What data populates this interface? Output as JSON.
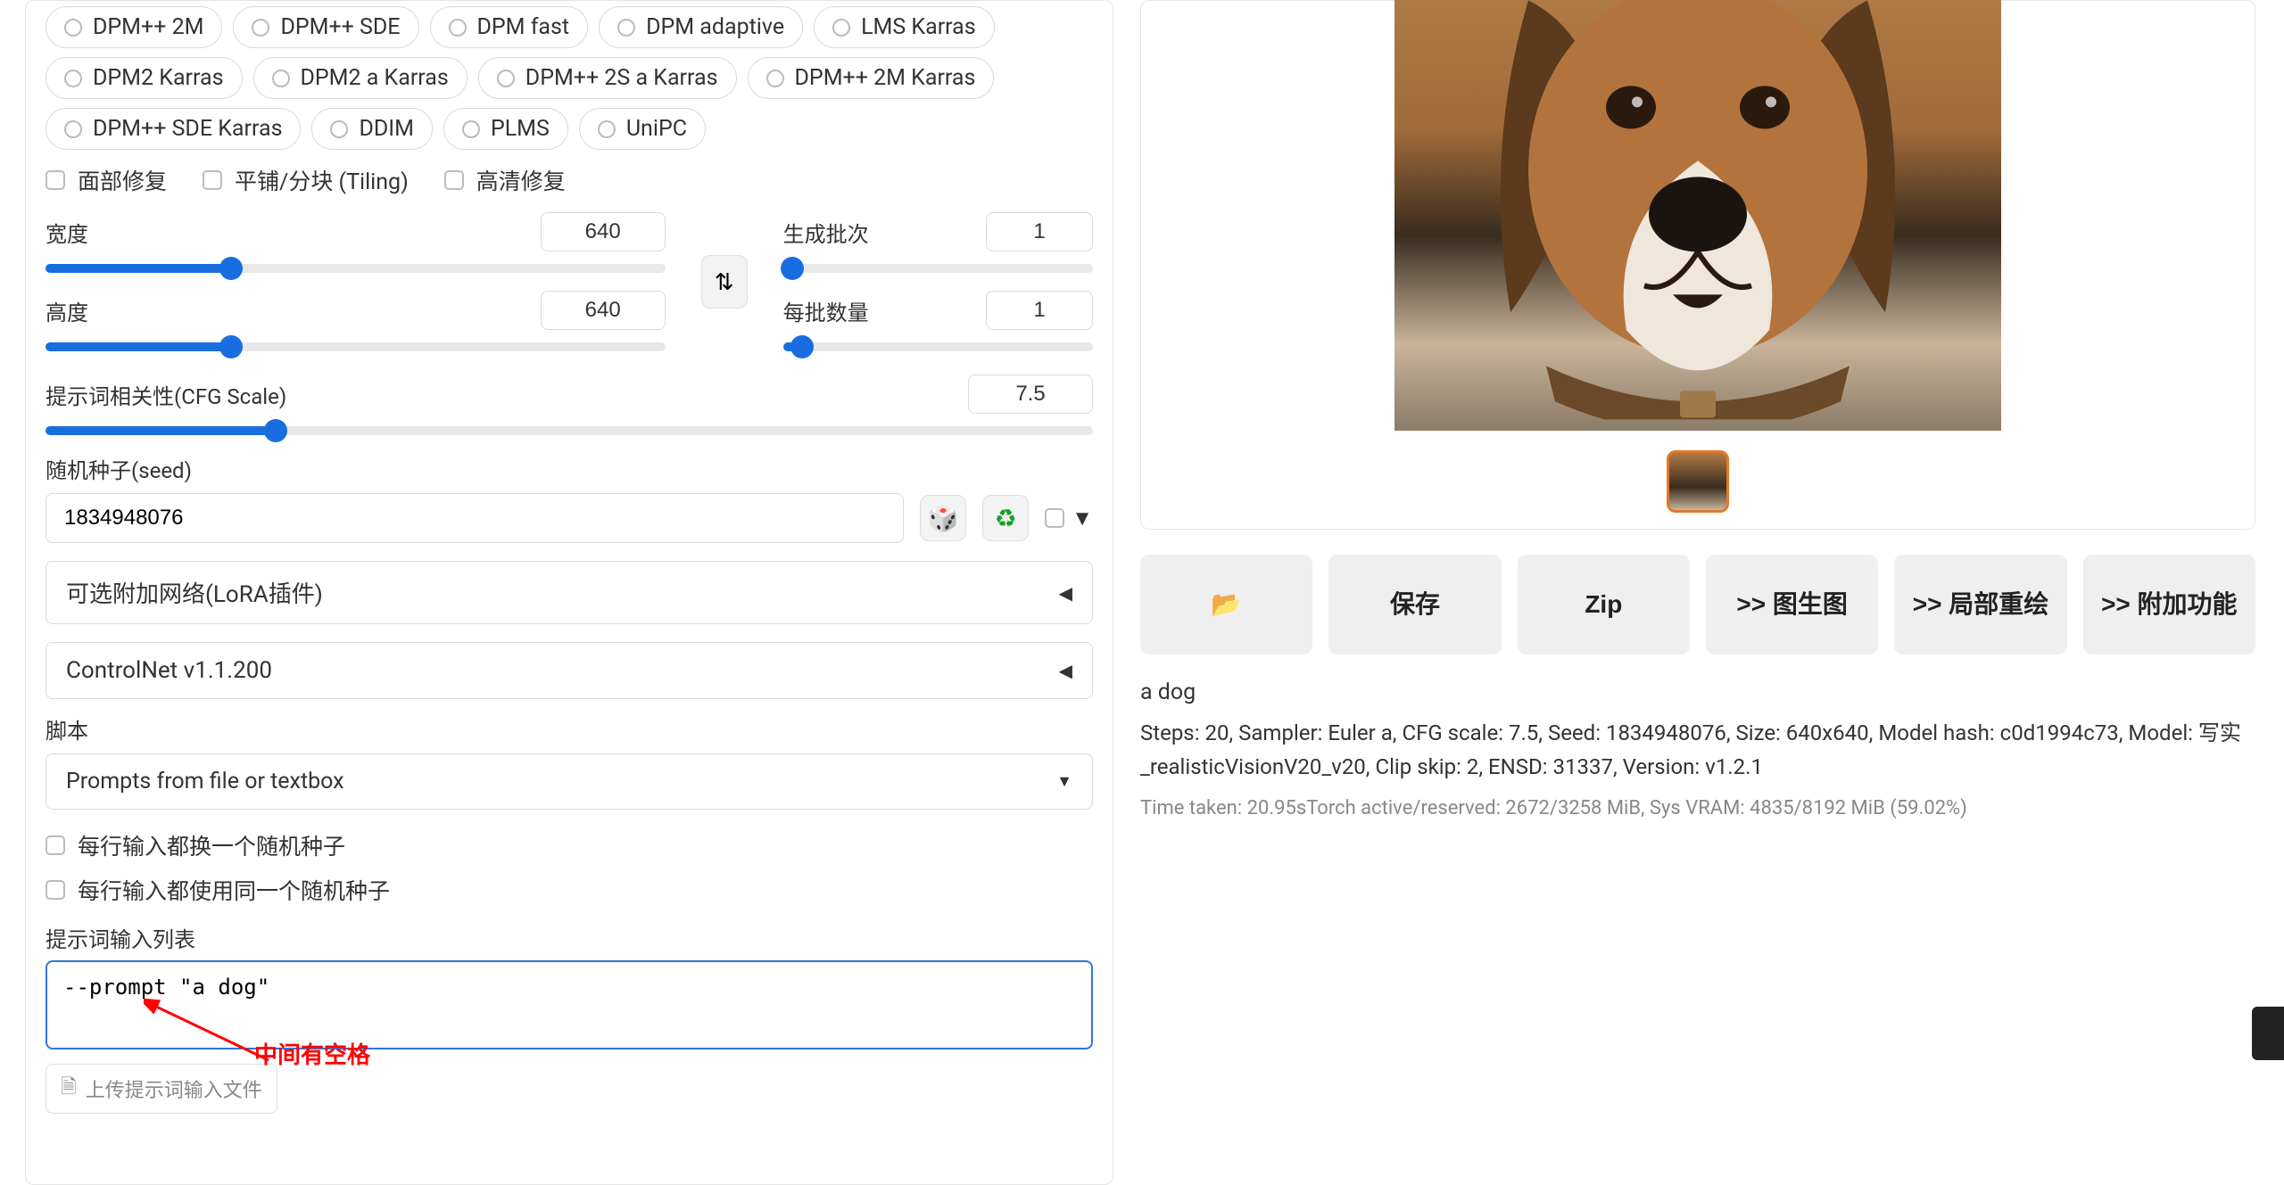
{
  "samplers_row1": [
    "DPM++ 2M",
    "DPM++ SDE",
    "DPM fast",
    "DPM adaptive",
    "LMS Karras"
  ],
  "samplers_row2": [
    "DPM2 Karras",
    "DPM2 a Karras",
    "DPM++ 2S a Karras",
    "DPM++ 2M Karras"
  ],
  "samplers_row3": [
    "DPM++ SDE Karras",
    "DDIM",
    "PLMS",
    "UniPC"
  ],
  "checkboxes": {
    "face_restore": "面部修复",
    "tiling": "平铺/分块 (Tiling)",
    "hires": "高清修复"
  },
  "sliders": {
    "width": {
      "label": "宽度",
      "value": "640",
      "fill_pct": 30
    },
    "height": {
      "label": "高度",
      "value": "640",
      "fill_pct": 30
    },
    "batch_count": {
      "label": "生成批次",
      "value": "1",
      "fill_pct": 0
    },
    "batch_size": {
      "label": "每批数量",
      "value": "1",
      "fill_pct": 6
    },
    "cfg": {
      "label": "提示词相关性(CFG Scale)",
      "value": "7.5",
      "fill_pct": 22
    }
  },
  "seed": {
    "label": "随机种子(seed)",
    "value": "1834948076"
  },
  "accordions": {
    "lora": "可选附加网络(LoRA插件)",
    "controlnet": "ControlNet v1.1.200"
  },
  "script": {
    "label": "脚本",
    "selected": "Prompts from file or textbox"
  },
  "script_opts": {
    "each_line_seed": "每行输入都换一个随机种子",
    "each_line_same_seed": "每行输入都使用同一个随机种子",
    "prompt_list_label": "提示词输入列表",
    "prompt_list_value": "--prompt \"a dog\"",
    "annotation": "中间有空格",
    "upload": "上传提示词输入文件"
  },
  "output": {
    "prompt": "a dog",
    "params": "Steps: 20, Sampler: Euler a, CFG scale: 7.5, Seed: 1834948076, Size: 640x640, Model hash: c0d1994c73, Model: 写实_realisticVisionV20_v20, Clip skip: 2, ENSD: 31337, Version: v1.2.1",
    "time": "Time taken: 20.95sTorch active/reserved: 2672/3258 MiB, Sys VRAM: 4835/8192 MiB (59.02%)"
  },
  "actions": {
    "folder": "📂",
    "save": "保存",
    "zip": "Zip",
    "img2img": ">> 图生图",
    "inpaint": ">> 局部重绘",
    "extras": ">> 附加功能"
  }
}
